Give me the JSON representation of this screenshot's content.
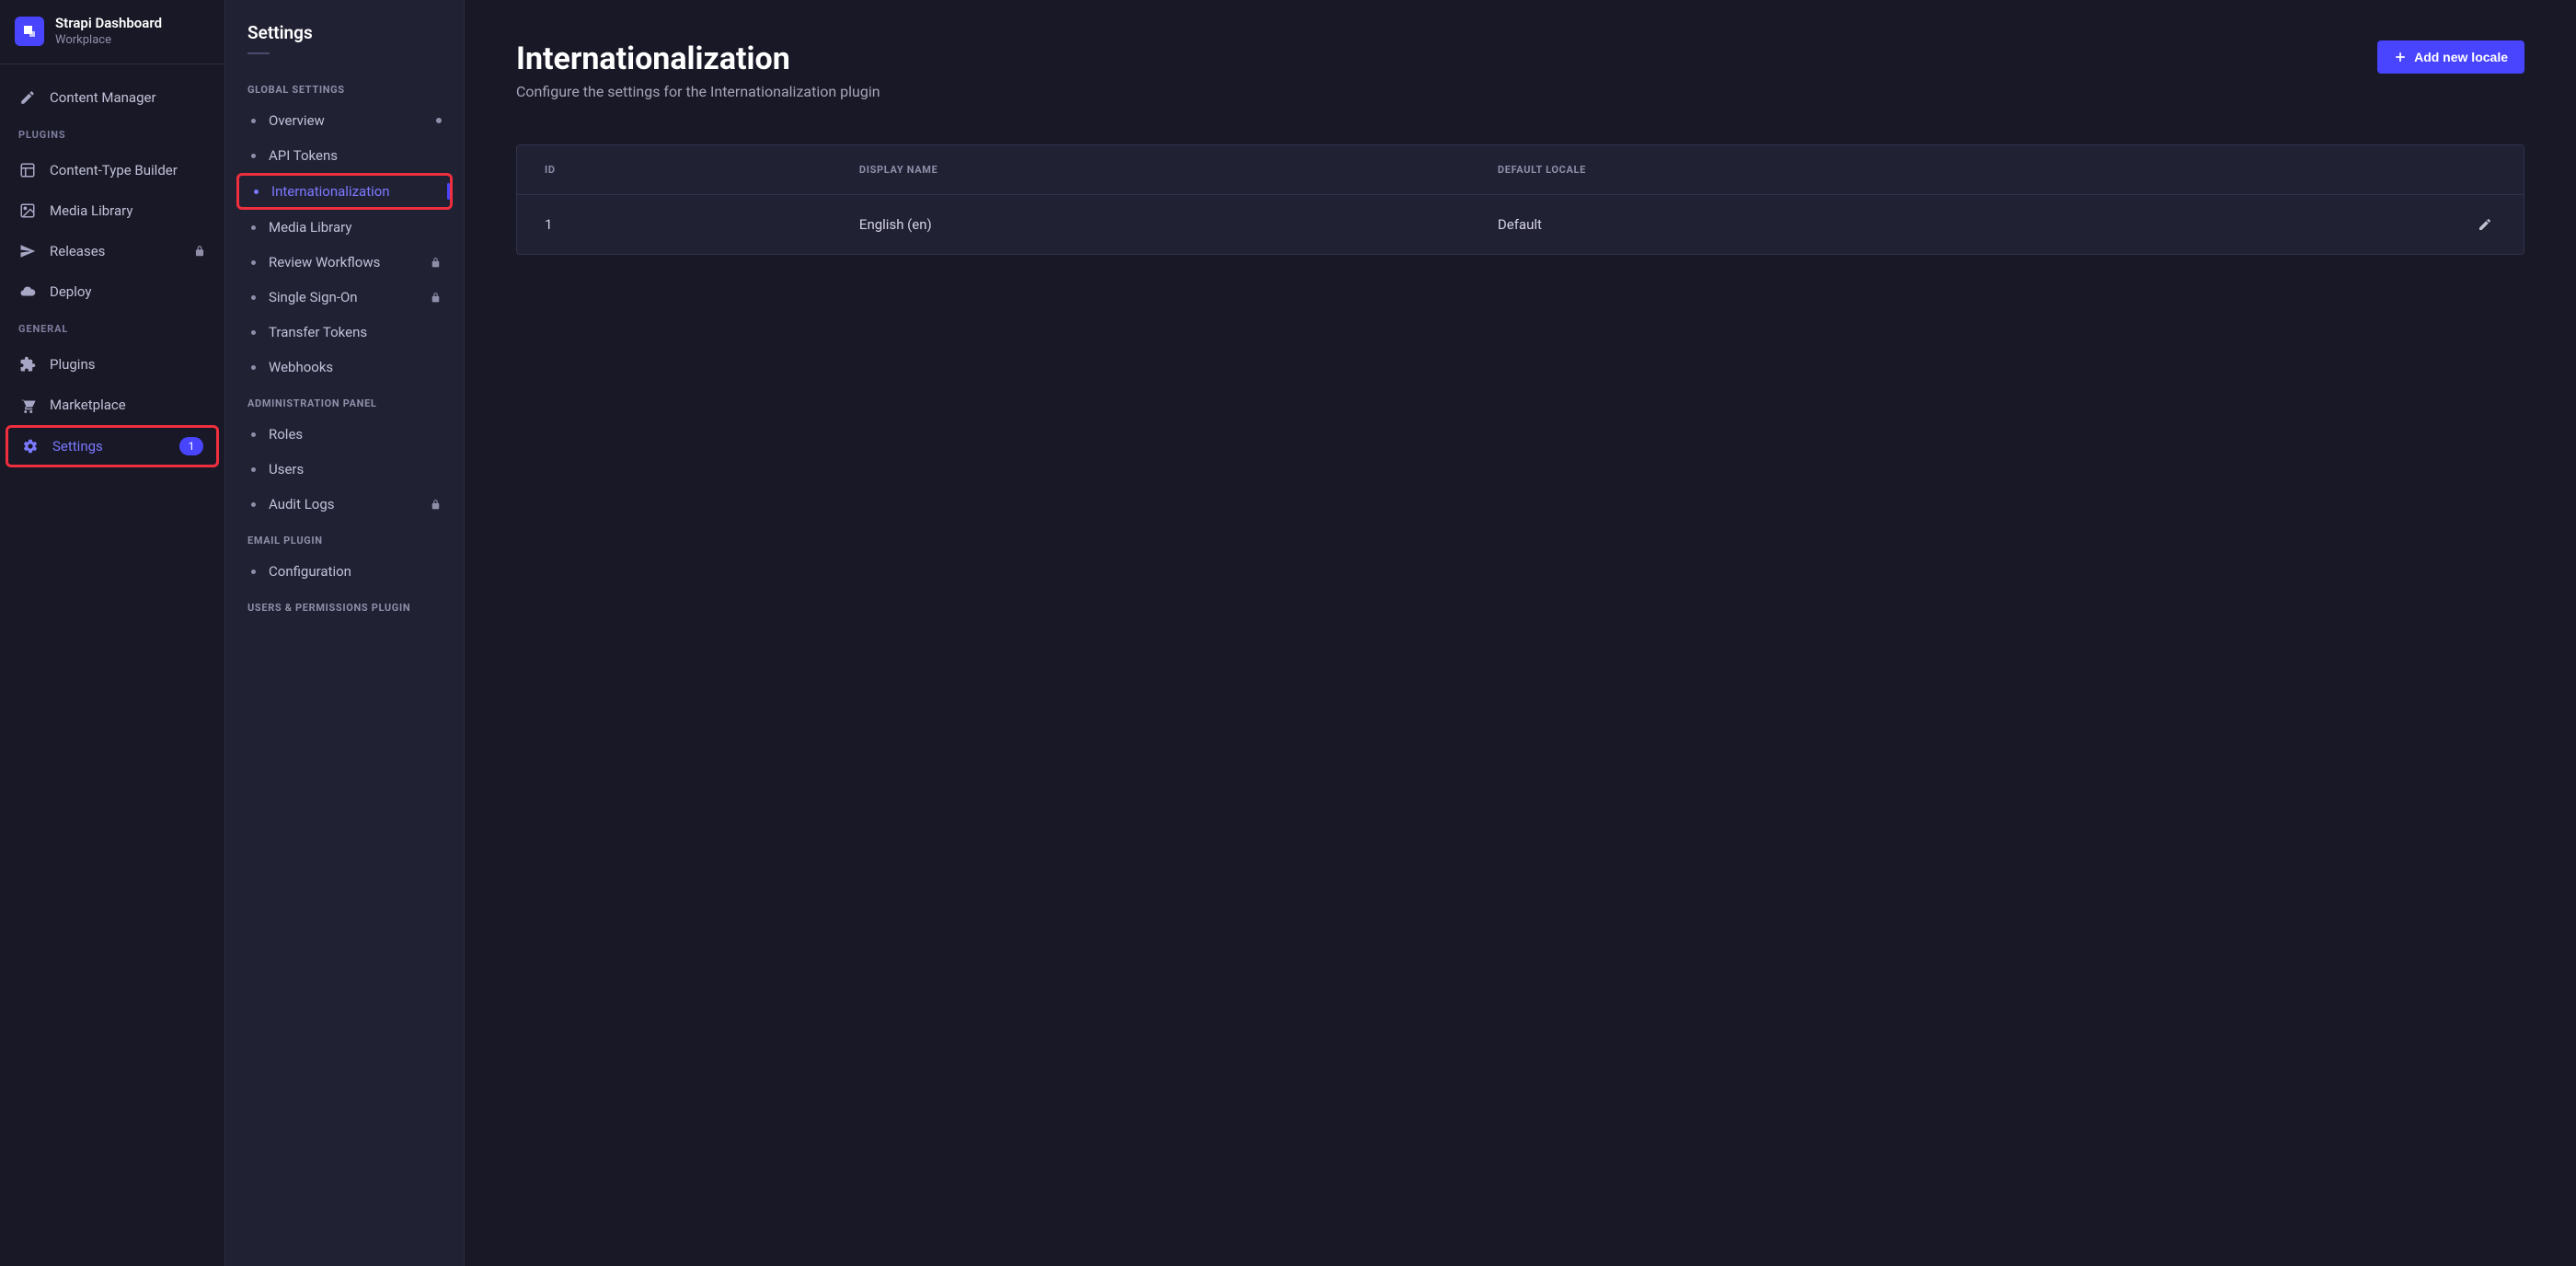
{
  "brand": {
    "title": "Strapi Dashboard",
    "subtitle": "Workplace"
  },
  "leftnav": {
    "content_manager": "Content Manager",
    "plugins_heading": "PLUGINS",
    "items_plugins": [
      {
        "label": "Content-Type Builder"
      },
      {
        "label": "Media Library"
      },
      {
        "label": "Releases",
        "locked": true
      },
      {
        "label": "Deploy"
      }
    ],
    "general_heading": "GENERAL",
    "items_general": [
      {
        "label": "Plugins"
      },
      {
        "label": "Marketplace"
      },
      {
        "label": "Settings",
        "badge": "1",
        "active": true,
        "highlight": true
      }
    ]
  },
  "subnav": {
    "title": "Settings",
    "sections": [
      {
        "heading": "GLOBAL SETTINGS",
        "items": [
          {
            "label": "Overview",
            "dot": true
          },
          {
            "label": "API Tokens"
          },
          {
            "label": "Internationalization",
            "active": true,
            "highlight": true
          },
          {
            "label": "Media Library"
          },
          {
            "label": "Review Workflows",
            "locked": true
          },
          {
            "label": "Single Sign-On",
            "locked": true
          },
          {
            "label": "Transfer Tokens"
          },
          {
            "label": "Webhooks"
          }
        ]
      },
      {
        "heading": "ADMINISTRATION PANEL",
        "items": [
          {
            "label": "Roles"
          },
          {
            "label": "Users"
          },
          {
            "label": "Audit Logs",
            "locked": true
          }
        ]
      },
      {
        "heading": "EMAIL PLUGIN",
        "items": [
          {
            "label": "Configuration"
          }
        ]
      },
      {
        "heading": "USERS & PERMISSIONS PLUGIN",
        "items": []
      }
    ]
  },
  "page": {
    "title": "Internationalization",
    "description": "Configure the settings for the Internationalization plugin",
    "add_button": "Add new locale"
  },
  "table": {
    "headers": {
      "id": "ID",
      "name": "DISPLAY NAME",
      "default": "DEFAULT LOCALE"
    },
    "rows": [
      {
        "id": "1",
        "name": "English (en)",
        "default": "Default"
      }
    ]
  }
}
